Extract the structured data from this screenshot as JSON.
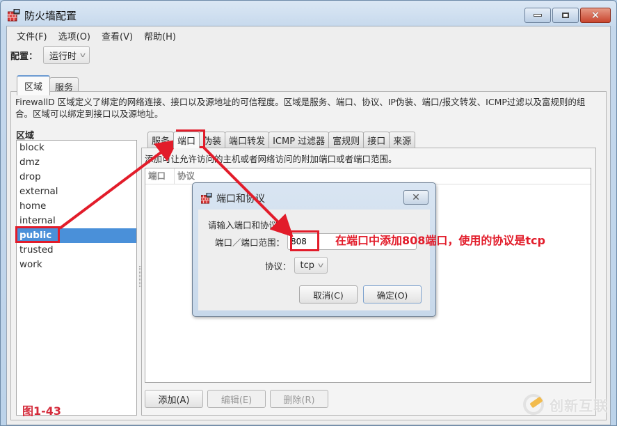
{
  "window": {
    "title": "防火墙配置",
    "icon": "firewall-icon",
    "controls": {
      "minimize": "minimize-icon",
      "maximize": "maximize-icon",
      "close": "close-icon"
    }
  },
  "menubar": [
    "文件(F)",
    "选项(O)",
    "查看(V)",
    "帮助(H)"
  ],
  "config": {
    "label": "配置：",
    "value": "运行时"
  },
  "top_tabs": [
    {
      "label": "区域",
      "active": true
    },
    {
      "label": "服务",
      "active": false
    }
  ],
  "zone_description": "FirewallD 区域定义了绑定的网络连接、接口以及源地址的可信程度。区域是服务、端口、协议、IP伪装、端口/报文转发、ICMP过滤以及富规则的组合。区域可以绑定到接口以及源地址。",
  "zones": {
    "label": "区域",
    "items": [
      "block",
      "dmz",
      "drop",
      "external",
      "home",
      "internal",
      "public",
      "trusted",
      "work"
    ],
    "selected": "public"
  },
  "inner_tabs": [
    {
      "label": "服务",
      "active": false
    },
    {
      "label": "端口",
      "active": true
    },
    {
      "label": "伪装",
      "active": false
    },
    {
      "label": "端口转发",
      "active": false
    },
    {
      "label": "ICMP 过滤器",
      "active": false
    },
    {
      "label": "富规则",
      "active": false
    },
    {
      "label": "接口",
      "active": false
    },
    {
      "label": "来源",
      "active": false
    }
  ],
  "ports_panel": {
    "description": "添加可让允许访问的主机或者网络访问的附加端口或者端口范围。",
    "columns": [
      "端口",
      "协议"
    ],
    "rows": [],
    "buttons": {
      "add": "添加(A)",
      "edit": "编辑(E)",
      "remove": "删除(R)"
    }
  },
  "dialog": {
    "title": "端口和协议",
    "prompt": "请输入端口和协议。",
    "port_label": "端口／端口范围：",
    "port_value": "808",
    "protocol_label": "协议：",
    "protocol_value": "tcp",
    "cancel": "取消(C)",
    "ok": "确定(O)"
  },
  "annotations": {
    "note": "在端口中添加808端口，使用的协议是tcp",
    "figure": "图1-43",
    "color": "#e21c2a"
  },
  "watermark": "创新互联"
}
